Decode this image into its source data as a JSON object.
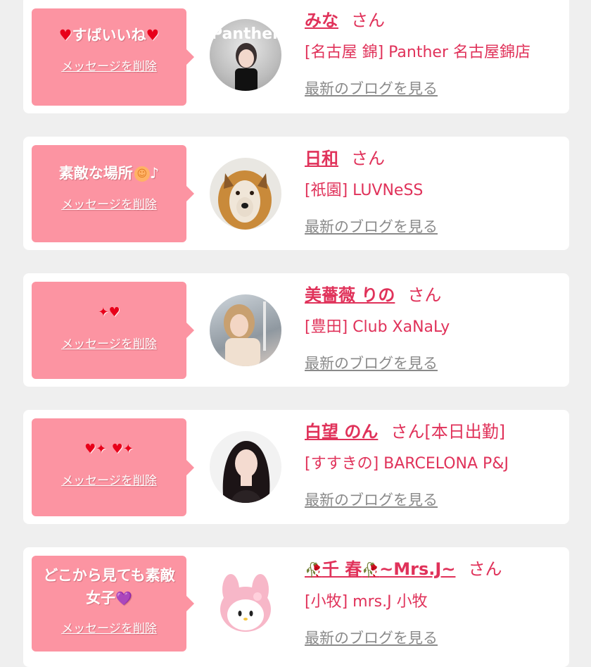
{
  "colors": {
    "bubble": "#fc94a2",
    "name": "#e0325a",
    "blog_link": "#8a8a8a",
    "background": "#efefef"
  },
  "common": {
    "delete_label": "メッセージを削除",
    "blog_label": "最新のブログを見る",
    "san": "さん"
  },
  "entries": [
    {
      "message": "すばいいね",
      "message_icons": [
        "heart-icon",
        "heart-icon"
      ],
      "name": "みな",
      "suffix": "",
      "shop": "[名古屋 錦] Panther 名古屋錦店",
      "avatar_overlay": "Panther"
    },
    {
      "message": "素敵な場所",
      "message_icons": [
        "smiley-icon",
        "music-note-icon"
      ],
      "music_note": "♪",
      "name": "日和",
      "suffix": "",
      "shop": "[祇園] LUVNeSS",
      "avatar_overlay": ""
    },
    {
      "message": "",
      "message_icons": [
        "sparkle-heart-icon"
      ],
      "name": "美薔薇 りの",
      "suffix": "",
      "shop": "[豊田] Club XaNaLy",
      "avatar_overlay": ""
    },
    {
      "message": "",
      "message_icons": [
        "sparkle-heart-icon",
        "sparkle-heart-icon"
      ],
      "name": "白望 のん",
      "suffix": "[本日出勤]",
      "shop": "[すすきの] BARCELONA P&J",
      "avatar_overlay": ""
    },
    {
      "message": "どこから見ても素敵女子",
      "message_icons": [
        "purple-heart-icon"
      ],
      "name": "千 春",
      "name_suffix": "~Mrs.J~",
      "suffix": "",
      "shop": "[小牧] mrs.J 小牧",
      "avatar_overlay": ""
    }
  ]
}
